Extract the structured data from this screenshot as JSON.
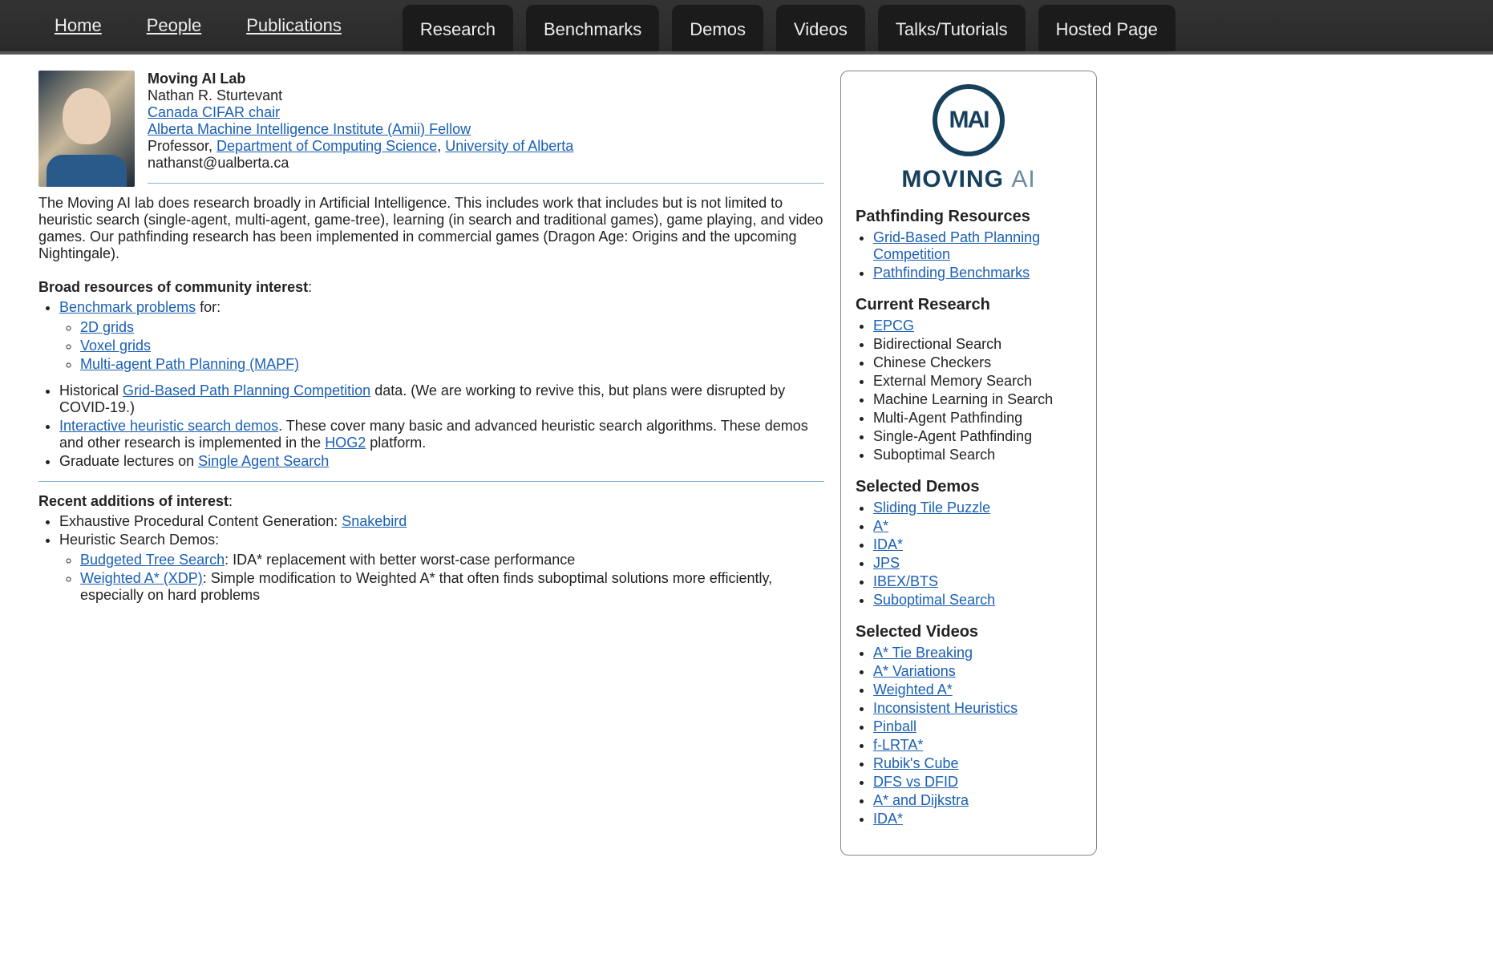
{
  "nav": {
    "links": [
      "Home",
      "People",
      "Publications"
    ],
    "tabs": [
      "Research",
      "Benchmarks",
      "Demos",
      "Videos",
      "Talks/Tutorials",
      "Hosted Page"
    ]
  },
  "header": {
    "lab": "Moving AI Lab",
    "name": "Nathan R. Sturtevant",
    "cifar": "Canada CIFAR chair",
    "amii": "Alberta Machine Intelligence Institute (Amii) Fellow",
    "prof_prefix": "Professor, ",
    "dept": "Department of Computing Science",
    "comma": ", ",
    "univ": "University of Alberta",
    "email": "nathanst@ualberta.ca"
  },
  "intro_para": "The Moving AI lab does research broadly in Artificial Intelligence. This includes work that includes but is not limited to heuristic search (single-agent, multi-agent, game-tree), learning (in search and traditional games), game playing, and video games. Our pathfinding research has been implemented in commercial games (Dragon Age: Origins and the upcoming Nightingale).",
  "broad": {
    "heading": "Broad resources of community interest",
    "colon": ":",
    "bench_link": "Benchmark problems",
    "bench_tail": " for:",
    "grids2d": "2D grids",
    "voxel": "Voxel grids",
    "mapf": "Multi-agent Path Planning (MAPF)",
    "hist_pre": "Historical ",
    "gppc": "Grid-Based Path Planning Competition",
    "hist_post": " data. (We are working to revive this, but plans were disrupted by COVID-19.)",
    "demos_link": "Interactive heuristic search demos",
    "demos_post_a": ". These cover many basic and advanced heuristic search algorithms. These demos and other research is implemented in the ",
    "hog2": "HOG2",
    "demos_post_b": " platform.",
    "grad_pre": "Graduate lectures on ",
    "sas": "Single Agent Search"
  },
  "recent": {
    "heading": "Recent additions of interest",
    "colon": ":",
    "epcg_pre": "Exhaustive Procedural Content Generation: ",
    "snakebird": "Snakebird",
    "hsd_label": "Heuristic Search Demos:",
    "bts": "Budgeted Tree Search",
    "bts_post": ": IDA* replacement with better worst-case performance",
    "xdp": "Weighted A* (XDP)",
    "xdp_post": ": Simple modification to Weighted A* that often finds suboptimal solutions more efficiently, especially on hard problems"
  },
  "sidebar": {
    "logo_letters": "MAI",
    "logo_word_a": "MOVING",
    "logo_word_b": "AI",
    "pathfinding": {
      "heading": "Pathfinding Resources",
      "items": [
        {
          "text": "Grid-Based Path Planning Competition",
          "link": true
        },
        {
          "text": "Pathfinding Benchmarks",
          "link": true
        }
      ]
    },
    "current": {
      "heading": "Current Research",
      "items": [
        {
          "text": "EPCG",
          "link": true
        },
        {
          "text": "Bidirectional Search",
          "link": false
        },
        {
          "text": "Chinese Checkers",
          "link": false
        },
        {
          "text": "External Memory Search",
          "link": false
        },
        {
          "text": "Machine Learning in Search",
          "link": false
        },
        {
          "text": "Multi-Agent Pathfinding",
          "link": false
        },
        {
          "text": "Single-Agent Pathfinding",
          "link": false
        },
        {
          "text": "Suboptimal Search",
          "link": false
        }
      ]
    },
    "demos": {
      "heading": "Selected Demos",
      "items": [
        {
          "text": "Sliding Tile Puzzle",
          "link": true
        },
        {
          "text": "A*",
          "link": true
        },
        {
          "text": "IDA*",
          "link": true
        },
        {
          "text": "JPS",
          "link": true
        },
        {
          "text": "IBEX/BTS",
          "link": true
        },
        {
          "text": "Suboptimal Search",
          "link": true
        }
      ]
    },
    "videos": {
      "heading": "Selected Videos",
      "items": [
        {
          "text": "A* Tie Breaking",
          "link": true
        },
        {
          "text": "A* Variations",
          "link": true
        },
        {
          "text": "Weighted A*",
          "link": true
        },
        {
          "text": "Inconsistent Heuristics",
          "link": true
        },
        {
          "text": "Pinball",
          "link": true
        },
        {
          "text": "f-LRTA*",
          "link": true
        },
        {
          "text": "Rubik's Cube",
          "link": true
        },
        {
          "text": "DFS vs DFID",
          "link": true
        },
        {
          "text": "A* and Dijkstra",
          "link": true
        },
        {
          "text": "IDA*",
          "link": true
        }
      ]
    }
  }
}
